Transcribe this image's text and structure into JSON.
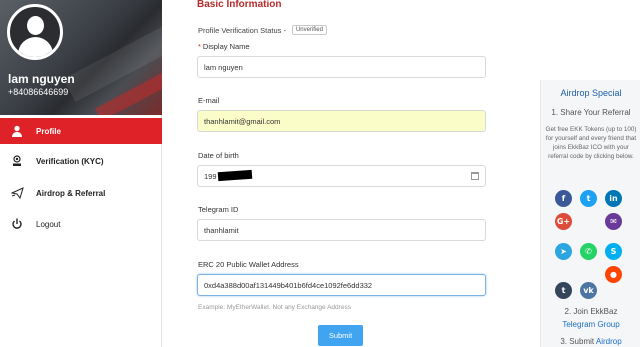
{
  "profile": {
    "name": "lam nguyen",
    "phone": "+84086646699"
  },
  "nav": [
    {
      "label": "Profile",
      "icon": "user-icon",
      "active": true
    },
    {
      "label": "Verification (KYC)",
      "icon": "id-badge-icon",
      "active": false
    },
    {
      "label": "Airdrop & Referral",
      "icon": "send-icon",
      "active": false
    },
    {
      "label": "Logout",
      "icon": "power-icon",
      "active": false
    }
  ],
  "form": {
    "section_title": "Basic Information",
    "status_label": "Profile Verification Status -",
    "status_badge": "Unverified",
    "display_name_label": "Display Name",
    "display_name_value": "lam nguyen",
    "email_label": "E-mail",
    "email_value": "thanhlamit@gmail.com",
    "dob_label": "Date of birth",
    "dob_value": "199",
    "telegram_label": "Telegram ID",
    "telegram_value": "thanhlamit",
    "wallet_label": "ERC 20 Public Wallet Address",
    "wallet_value": "0xd4a388d00af131449b401b6fd4ce1092fe6dd332",
    "wallet_hint": "Example: MyEtherWallet. Not any Exchange Address",
    "submit_label": "Submit"
  },
  "airdrop": {
    "title": "Airdrop Special",
    "step1": "1. Share Your Referral",
    "step1_desc": "Get free EKK Tokens (up to 100) for yourself and every friend that joins EkkBaz ICO with your referral code by clicking below.",
    "social_icons": [
      {
        "name": "facebook-icon",
        "glyph": "f",
        "color": "#3b5998"
      },
      {
        "name": "twitter-icon",
        "glyph": "t",
        "color": "#1da1f2"
      },
      {
        "name": "linkedin-icon",
        "glyph": "in",
        "color": "#0077b5"
      },
      {
        "name": "google-plus-icon",
        "glyph": "G+",
        "color": "#dd4b39"
      },
      {
        "name": "email-icon",
        "glyph": "✉",
        "color": "#6a3a9a"
      },
      {
        "name": "telegram-icon",
        "glyph": "➤",
        "color": "#2ca5e0"
      },
      {
        "name": "whatsapp-icon",
        "glyph": "✆",
        "color": "#25d366"
      },
      {
        "name": "skype-icon",
        "glyph": "S",
        "color": "#00aff0"
      },
      {
        "name": "reddit-icon",
        "glyph": "●",
        "color": "#ff4500"
      },
      {
        "name": "tumblr-icon",
        "glyph": "t",
        "color": "#35465c"
      },
      {
        "name": "vk-icon",
        "glyph": "vk",
        "color": "#4c75a3"
      }
    ],
    "step2": "2. Join EkkBaz",
    "step2_link": "Telegram Group",
    "step3": "3. Submit",
    "step3_link": "Airdrop"
  }
}
